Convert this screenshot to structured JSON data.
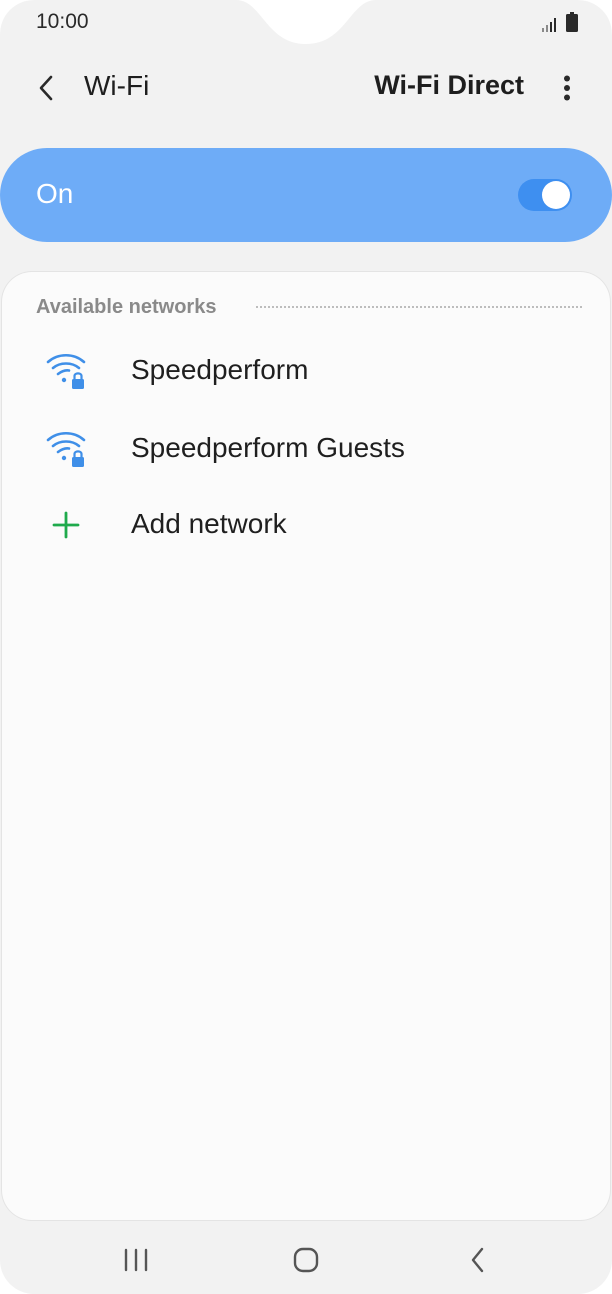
{
  "status_bar": {
    "time": "10:00",
    "signal_icon": "signal-icon",
    "battery_icon": "battery-icon"
  },
  "app_bar": {
    "back_icon": "back-arrow-icon",
    "title": "Wi-Fi",
    "wifi_direct_label": "Wi-Fi Direct",
    "more_icon": "more-options-icon"
  },
  "master_switch": {
    "label": "On",
    "state": "on"
  },
  "available_networks": {
    "header": "Available networks",
    "items": [
      {
        "name": "Speedperform",
        "icon": "wifi-secured-icon"
      },
      {
        "name": "Speedperform Guests",
        "icon": "wifi-secured-icon"
      }
    ],
    "add_network": {
      "label": "Add network",
      "icon": "plus-icon"
    }
  },
  "nav_bar": {
    "recents_icon": "recents-icon",
    "home_icon": "home-icon",
    "back_icon": "nav-back-icon"
  },
  "colors": {
    "accent": "#6eacf7",
    "switch_track": "#3e8ff0",
    "wifi_icon": "#3f8fe8",
    "add_icon": "#1faa4c",
    "background": "#f2f2f2",
    "card": "#fbfbfb"
  }
}
